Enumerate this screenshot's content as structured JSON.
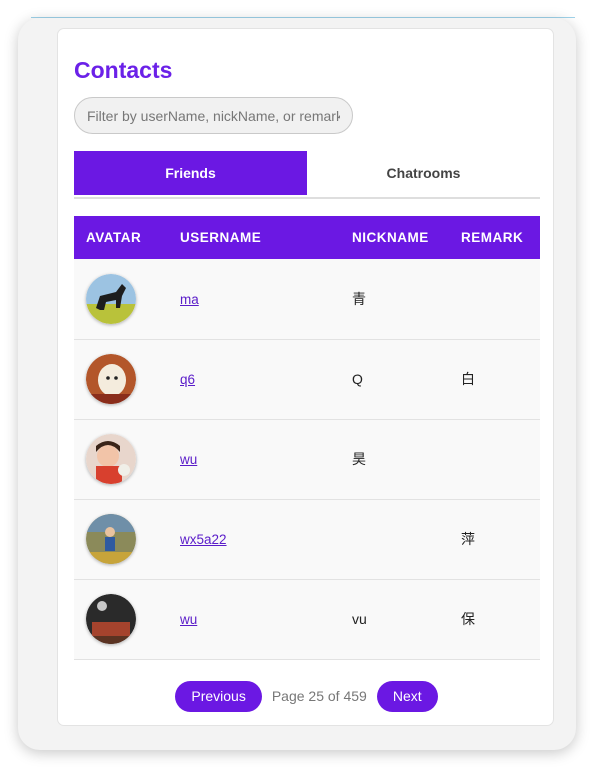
{
  "contacts": {
    "title": "Contacts",
    "search_placeholder": "Filter by userName, nickName, or remark",
    "tabs": [
      {
        "label": "Friends",
        "active": true
      },
      {
        "label": "Chatrooms",
        "active": false
      }
    ],
    "columns": [
      "AVATAR",
      "USERNAME",
      "NICKNAME",
      "REMARK"
    ],
    "rows": [
      {
        "avatar_icon": "horse-photo-avatar",
        "username": "ma",
        "nickname": "青",
        "remark": ""
      },
      {
        "avatar_icon": "dog-photo-avatar",
        "username": "q6",
        "nickname": "Q",
        "remark": "白"
      },
      {
        "avatar_icon": "child-photo-avatar",
        "username": "wu",
        "nickname": "昊",
        "remark": ""
      },
      {
        "avatar_icon": "outdoor-photo-avatar",
        "username": "wx5a22",
        "nickname": "",
        "remark": "萍"
      },
      {
        "avatar_icon": "stage-photo-avatar",
        "username": "wu",
        "nickname": "vu",
        "remark": "保"
      }
    ],
    "pagination": {
      "previous_label": "Previous",
      "page_info": "Page 25 of 459",
      "next_label": "Next"
    }
  },
  "colors": {
    "accent": "#6b18e3",
    "title": "#6b21e8",
    "link": "#5a1cc9"
  }
}
